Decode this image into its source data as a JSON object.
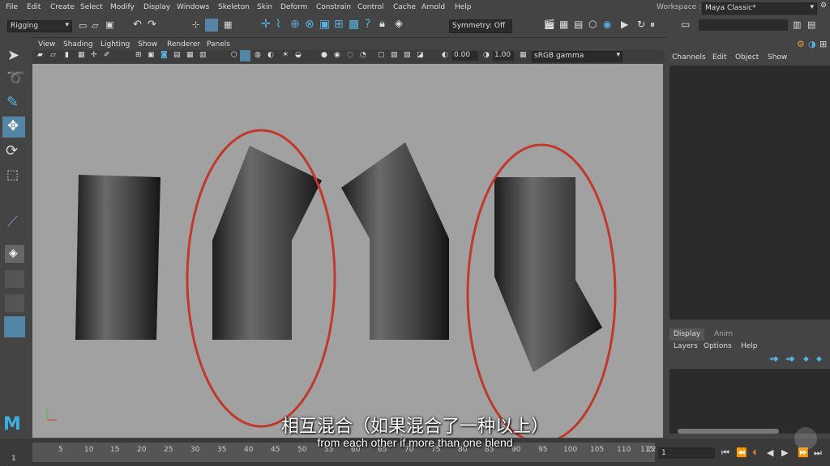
{
  "menu": [
    "File",
    "Edit",
    "Create",
    "Select",
    "Modify",
    "Display",
    "Windows",
    "Skeleton",
    "Skin",
    "Deform",
    "Constrain",
    "Control",
    "Cache",
    "Arnold",
    "Help"
  ],
  "workspace": {
    "label": "Workspace :",
    "value": "Maya Classic*"
  },
  "shelf": {
    "mode": "Rigging",
    "symmetry": "Symmetry: Off"
  },
  "panel_menu": [
    "View",
    "Shading",
    "Lighting",
    "Show",
    "Renderer",
    "Panels"
  ],
  "panel_toolbar": {
    "value1": "0.00",
    "value2": "1.00",
    "colorspace": "sRGB gamma"
  },
  "channel_box": {
    "tabs": [
      "Channels",
      "Edit",
      "Object",
      "Show"
    ]
  },
  "layer_editor": {
    "tabs": [
      "Display",
      "Anim"
    ],
    "menu": [
      "Layers",
      "Options",
      "Help"
    ]
  },
  "timeline": {
    "ticks": [
      "5",
      "10",
      "15",
      "20",
      "25",
      "30",
      "35",
      "40",
      "45",
      "50",
      "55",
      "60",
      "65",
      "70",
      "75",
      "80",
      "85",
      "90",
      "95",
      "100",
      "105",
      "110",
      "115",
      "12"
    ],
    "start_frame": "1",
    "current_frame": "1"
  },
  "subtitles": {
    "chinese": "相互混合（如果混合了一种以上）",
    "english": "from each other if more than one blend"
  },
  "colors": {
    "viewport_bg": "#a1a1a1",
    "ui_bg": "#444444",
    "highlight": "#5285a6",
    "circle": "#c0392b"
  }
}
